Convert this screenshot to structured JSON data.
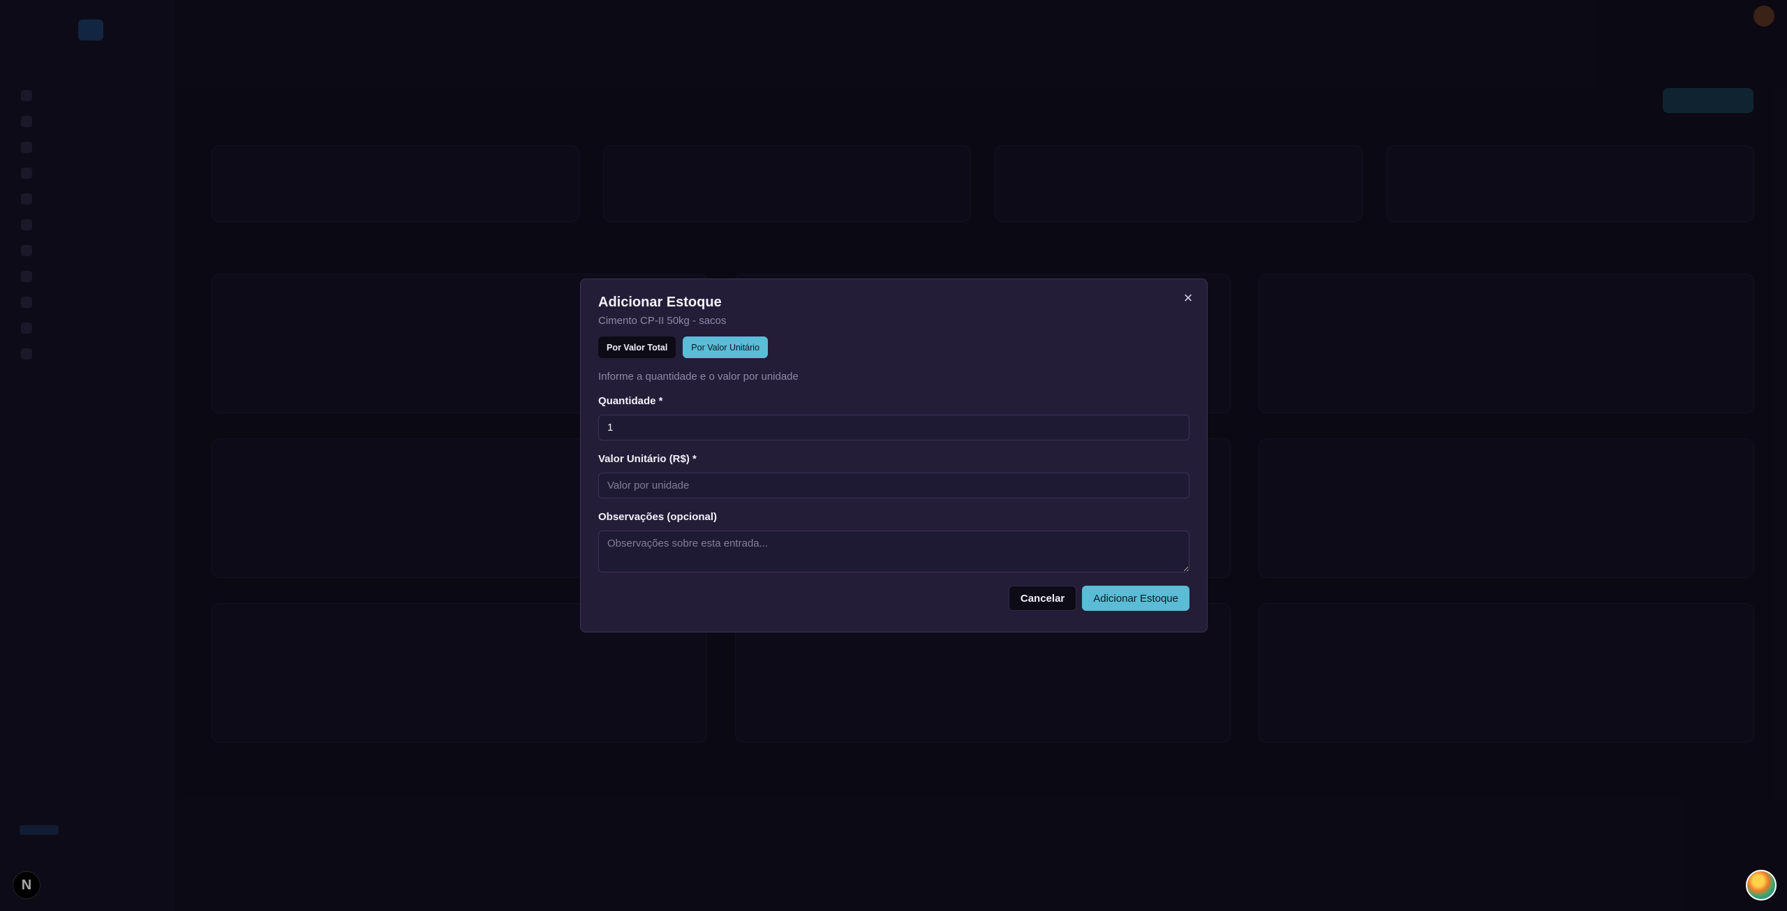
{
  "modal": {
    "title": "Adicionar Estoque",
    "subtitle": "Cimento CP-II 50kg - sacos",
    "close_icon": "×",
    "mode_options": [
      {
        "label": "Por Valor Total",
        "selected": false
      },
      {
        "label": "Por Valor Unitário",
        "selected": true
      }
    ],
    "hint": "Informe a quantidade e o valor por unidade",
    "quantity": {
      "label": "Quantidade *",
      "value": "1"
    },
    "unit_value": {
      "label": "Valor Unitário (R$) *",
      "value": "",
      "placeholder": "Valor por unidade"
    },
    "notes": {
      "label": "Observações (opcional)",
      "value": "",
      "placeholder": "Observações sobre esta entrada..."
    },
    "cancel_label": "Cancelar",
    "submit_label": "Adicionar Estoque"
  },
  "background": {
    "next_badge": "N"
  },
  "colors": {
    "accent": "#5bbcd6",
    "modal_bg": "#231d38",
    "page_bg": "#120f1f"
  }
}
